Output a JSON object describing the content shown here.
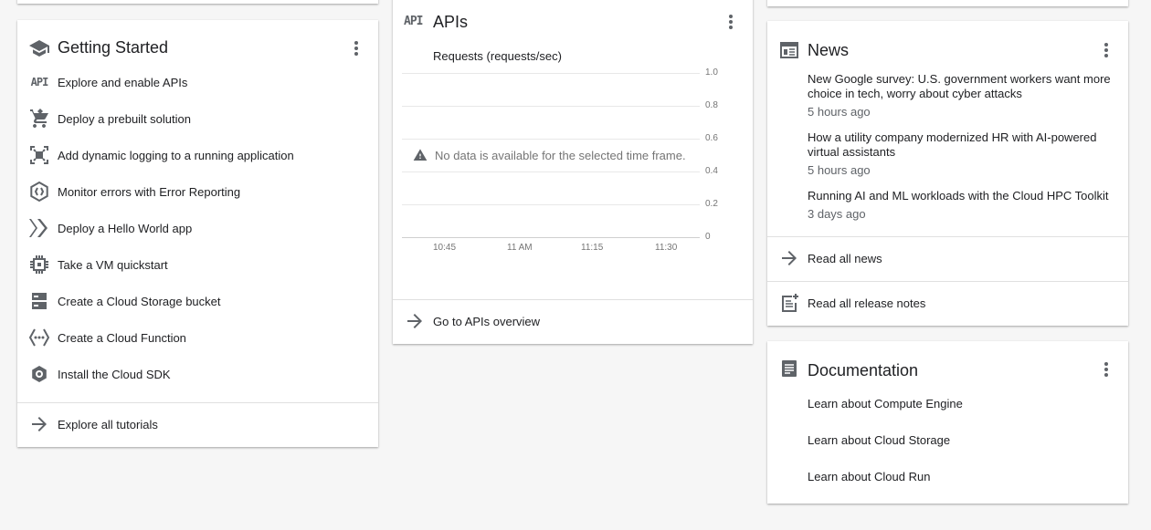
{
  "getting_started": {
    "title": "Getting Started",
    "items": [
      {
        "label": "Explore and enable APIs",
        "icon": "api-icon"
      },
      {
        "label": "Deploy a prebuilt solution",
        "icon": "cart-icon"
      },
      {
        "label": "Add dynamic logging to a running application",
        "icon": "debugger-icon"
      },
      {
        "label": "Monitor errors with Error Reporting",
        "icon": "error-reporting-icon"
      },
      {
        "label": "Deploy a Hello World app",
        "icon": "app-engine-icon"
      },
      {
        "label": "Take a VM quickstart",
        "icon": "chip-icon"
      },
      {
        "label": "Create a Cloud Storage bucket",
        "icon": "storage-icon"
      },
      {
        "label": "Create a Cloud Function",
        "icon": "function-icon"
      },
      {
        "label": "Install the Cloud SDK",
        "icon": "sdk-icon"
      }
    ],
    "footer_link": "Explore all tutorials",
    "header_icon": "graduation-cap-icon"
  },
  "apis": {
    "icon_text": "API",
    "title": "APIs",
    "chart_title": "Requests (requests/sec)",
    "no_data": "No data is available for the selected time frame.",
    "footer_link": "Go to APIs overview"
  },
  "chart_data": {
    "type": "line",
    "title": "Requests (requests/sec)",
    "x_ticks": [
      "10:45",
      "11 AM",
      "11:15",
      "11:30"
    ],
    "y_ticks": [
      "1.0",
      "0.8",
      "0.6",
      "0.4",
      "0.2",
      "0"
    ],
    "ylim": [
      0,
      1.0
    ],
    "series": [],
    "grid": true
  },
  "news": {
    "title": "News",
    "header_icon": "newspaper-icon",
    "items": [
      {
        "title": "New Google survey: U.S. government workers want more choice in tech, worry about cyber attacks",
        "time": "5 hours ago"
      },
      {
        "title": "How a utility company modernized HR with AI-powered virtual assistants",
        "time": "5 hours ago"
      },
      {
        "title": "Running AI and ML workloads with the Cloud HPC Toolkit",
        "time": "3 days ago"
      }
    ],
    "read_all_news": "Read all news",
    "read_all_release_notes": "Read all release notes"
  },
  "documentation": {
    "title": "Documentation",
    "header_icon": "document-icon",
    "links": [
      "Learn about Compute Engine",
      "Learn about Cloud Storage",
      "Learn about Cloud Run"
    ]
  },
  "colors": {
    "background": "#f6f6f6",
    "icon": "#5f6368",
    "text": "#202124",
    "divider": "#e0e0e0"
  }
}
